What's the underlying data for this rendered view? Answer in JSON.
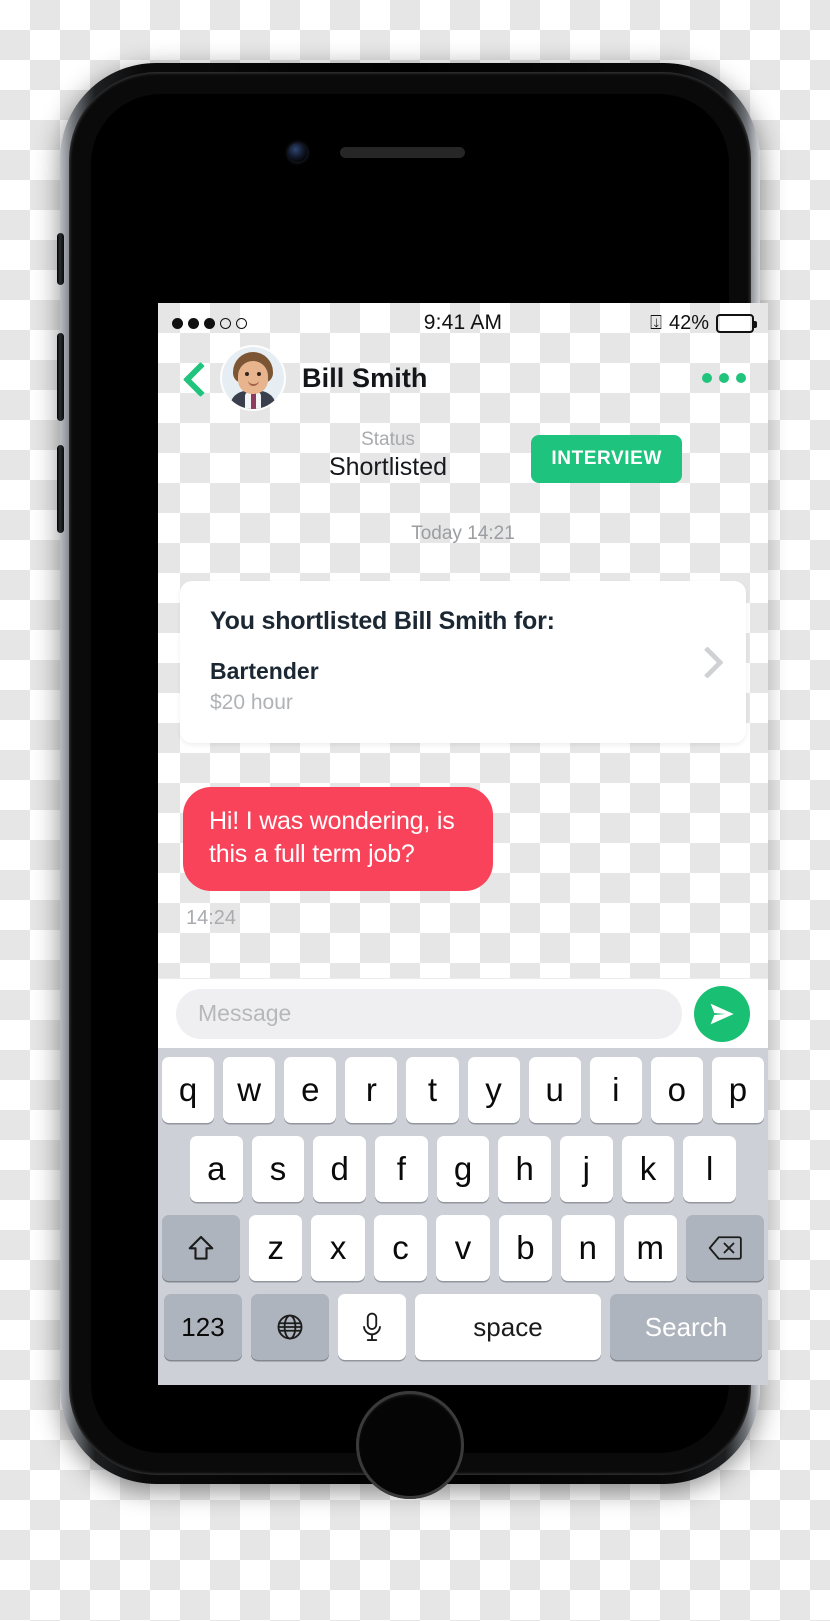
{
  "status_bar": {
    "signal_dots_filled": 3,
    "signal_dots_total": 5,
    "time": "9:41 AM",
    "bluetooth_icon": "bluetooth-icon",
    "battery_percent": "42%",
    "battery_level": 42
  },
  "nav": {
    "back_icon": "chevron-left-icon",
    "avatar_alt": "Bill Smith avatar",
    "title": "Bill Smith",
    "more_icon": "more-options-icon"
  },
  "status_row": {
    "label": "Status",
    "value": "Shortlisted",
    "action_label": "INTERVIEW"
  },
  "conversation": {
    "day_stamp": "Today 14:21",
    "job_card": {
      "headline": "You shortlisted Bill Smith for:",
      "job_title": "Bartender",
      "rate": "$20 hour",
      "chevron_icon": "chevron-right-icon"
    },
    "messages": [
      {
        "text": "Hi! I was wondering, is this a full term job?",
        "time": "14:24",
        "side": "incoming",
        "color": "#f9435a"
      }
    ]
  },
  "composer": {
    "placeholder": "Message",
    "value": "",
    "send_icon": "send-icon"
  },
  "keyboard": {
    "row1": [
      "q",
      "w",
      "e",
      "r",
      "t",
      "y",
      "u",
      "i",
      "o",
      "p"
    ],
    "row2": [
      "a",
      "s",
      "d",
      "f",
      "g",
      "h",
      "j",
      "k",
      "l"
    ],
    "row3": [
      "z",
      "x",
      "c",
      "v",
      "b",
      "n",
      "m"
    ],
    "shift_icon": "shift-arrow-icon",
    "delete_icon": "backspace-icon",
    "numbers_label": "123",
    "globe_icon": "globe-icon",
    "mic_icon": "microphone-icon",
    "space_label": "space",
    "return_label": "Search"
  },
  "colors": {
    "accent_green": "#1ec37d",
    "bubble_red": "#f9435a",
    "keyboard_bg": "#cdd1d7"
  }
}
